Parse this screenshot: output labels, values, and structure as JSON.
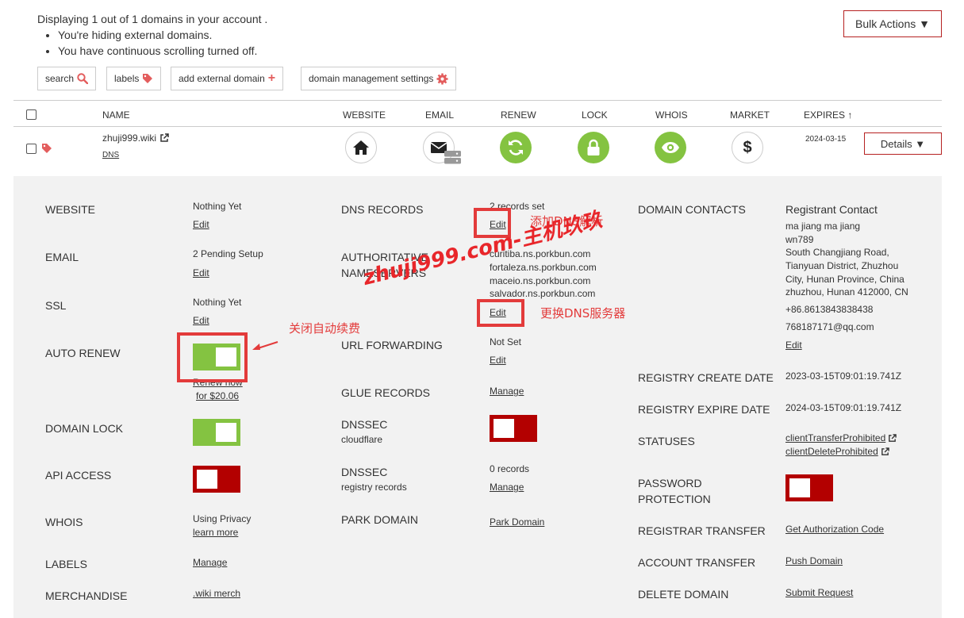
{
  "summary": {
    "displaying": "Displaying 1 out of 1 domains in your account .",
    "notes": [
      "You're hiding external domains.",
      "You have continuous scrolling turned off."
    ]
  },
  "bulk_actions": "Bulk Actions ▼",
  "toolbar": {
    "search": "search",
    "labels": "labels",
    "add_external": "add external domain",
    "mgmt_settings": "domain management settings"
  },
  "table": {
    "headers": {
      "name": "NAME",
      "website": "WEBSITE",
      "email": "EMAIL",
      "renew": "RENEW",
      "lock": "LOCK",
      "whois": "WHOIS",
      "market": "MARKET",
      "expires": "EXPIRES"
    },
    "row": {
      "domain": "zhuji999.wiki",
      "dns_link": "DNS",
      "expires": "2024-03-15",
      "details": "Details ▼"
    }
  },
  "details": {
    "col1": {
      "website": {
        "label": "WEBSITE",
        "value": "Nothing Yet",
        "link": "Edit"
      },
      "email": {
        "label": "EMAIL",
        "value": "2 Pending Setup",
        "link": "Edit"
      },
      "ssl": {
        "label": "SSL",
        "value": "Nothing Yet",
        "link": "Edit"
      },
      "auto_renew": {
        "label": "AUTO RENEW",
        "renew_now": "Renew now",
        "price": "for $20.06"
      },
      "domain_lock": {
        "label": "DOMAIN LOCK"
      },
      "api_access": {
        "label": "API ACCESS"
      },
      "whois": {
        "label": "WHOIS",
        "value": "Using Privacy",
        "link": "learn more"
      },
      "labels": {
        "label": "LABELS",
        "link": "Manage"
      },
      "merch": {
        "label": "MERCHANDISE",
        "link": ".wiki merch"
      }
    },
    "col2": {
      "dns_records": {
        "label": "DNS RECORDS",
        "value": "2 records set",
        "link": "Edit"
      },
      "nameservers": {
        "label1": "AUTHORITATIVE",
        "label2": "NAMESERVERS",
        "servers": [
          "curitiba.ns.porkbun.com",
          "fortaleza.ns.porkbun.com",
          "maceio.ns.porkbun.com",
          "salvador.ns.porkbun.com"
        ],
        "link": "Edit"
      },
      "url_forwarding": {
        "label": "URL FORWARDING",
        "value": "Not Set",
        "link": "Edit"
      },
      "glue": {
        "label": "GLUE RECORDS",
        "link": "Manage"
      },
      "dnssec_cf": {
        "label": "DNSSEC",
        "sub": "cloudflare"
      },
      "dnssec_reg": {
        "label": "DNSSEC",
        "sub": "registry records",
        "value": "0 records",
        "link": "Manage"
      },
      "park": {
        "label": "PARK DOMAIN",
        "link": "Park Domain"
      }
    },
    "col3": {
      "contacts": {
        "label": "DOMAIN CONTACTS",
        "title": "Registrant Contact",
        "lines": [
          "ma jiang ma jiang",
          "wn789",
          "South Changjiang Road,",
          "Tianyuan District, Zhuzhou",
          "City, Hunan Province, China",
          "zhuzhou, Hunan 412000, CN"
        ],
        "phone": "+86.8613843838438",
        "email": "768187171@qq.com",
        "link": "Edit"
      },
      "create": {
        "label": "REGISTRY CREATE DATE",
        "value": "2023-03-15T09:01:19.741Z"
      },
      "expire": {
        "label": "REGISTRY EXPIRE DATE",
        "value": "2024-03-15T09:01:19.741Z"
      },
      "statuses": {
        "label": "STATUSES",
        "items": [
          "clientTransferProhibited",
          "clientDeleteProhibited"
        ]
      },
      "password": {
        "label1": "PASSWORD",
        "label2": "PROTECTION"
      },
      "registrar_transfer": {
        "label": "REGISTRAR TRANSFER",
        "link": "Get Authorization Code"
      },
      "account_transfer": {
        "label": "ACCOUNT TRANSFER",
        "link": "Push Domain"
      },
      "delete": {
        "label": "DELETE DOMAIN",
        "link": "Submit Request"
      }
    }
  },
  "toggles": {
    "auto_renew": "on",
    "domain_lock": "on",
    "api_access": "off",
    "dnssec": "off",
    "password_protection": "off"
  },
  "annotations": {
    "add_dns": "添加DNS解析",
    "change_dns": "更换DNS服务器",
    "close_autorenew": "关闭自动续费",
    "watermark": "zhuji999.com-主机玖玖"
  },
  "colors": {
    "green": "#84c341",
    "red_toggle": "#b30000",
    "annotation": "#e33b3b",
    "panel_bg": "#f2f2f2"
  }
}
